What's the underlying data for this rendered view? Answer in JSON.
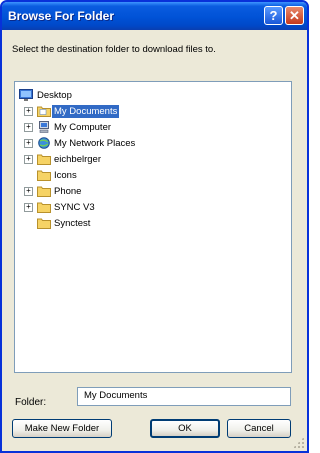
{
  "window": {
    "title": "Browse For Folder",
    "help_button": "?",
    "close_button": "✕"
  },
  "instruction": "Select the destination folder to download files to.",
  "tree": {
    "root": {
      "label": "Desktop",
      "icon": "desktop-icon"
    },
    "items": [
      {
        "label": "My Documents",
        "icon": "my-documents-folder-icon",
        "expandable": true,
        "selected": true
      },
      {
        "label": "My Computer",
        "icon": "my-computer-icon",
        "expandable": true,
        "selected": false
      },
      {
        "label": "My Network Places",
        "icon": "network-places-icon",
        "expandable": true,
        "selected": false
      },
      {
        "label": "eichbelrger",
        "icon": "folder-icon",
        "expandable": true,
        "selected": false
      },
      {
        "label": "Icons",
        "icon": "folder-icon",
        "expandable": false,
        "selected": false
      },
      {
        "label": "Phone",
        "icon": "folder-icon",
        "expandable": true,
        "selected": false
      },
      {
        "label": "SYNC V3",
        "icon": "folder-icon",
        "expandable": true,
        "selected": false
      },
      {
        "label": "Synctest",
        "icon": "folder-icon",
        "expandable": false,
        "selected": false
      }
    ]
  },
  "folder_field": {
    "label": "Folder:",
    "value": "My Documents"
  },
  "buttons": {
    "make_new_folder": "Make New Folder",
    "ok": "OK",
    "cancel": "Cancel"
  },
  "colors": {
    "selection": "#316ac5",
    "titlebar": "#0052d6",
    "dialog_bg": "#ece9d8"
  }
}
